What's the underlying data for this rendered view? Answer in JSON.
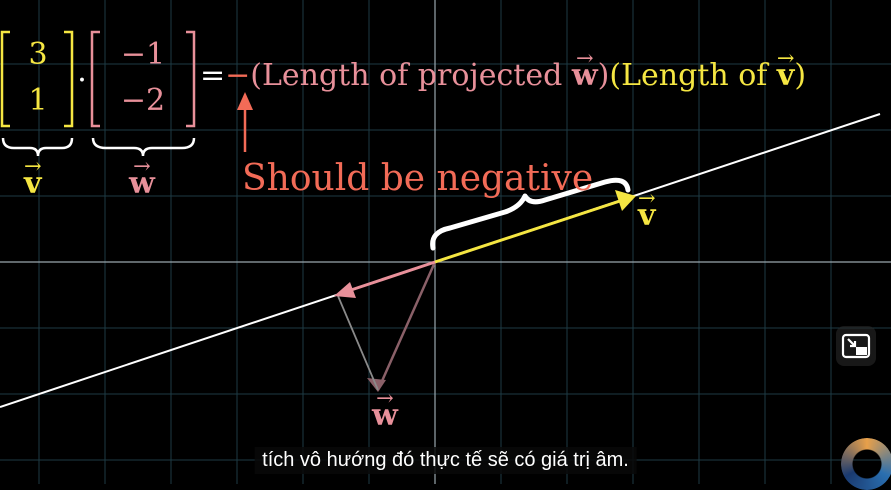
{
  "matrix_v": {
    "top": "3",
    "bottom": "1"
  },
  "matrix_w": {
    "top": "−1",
    "bottom": "−2"
  },
  "dot_symbol": "·",
  "equation": {
    "equals": "=",
    "minus": "−",
    "part1_open": "(Length of projected ",
    "part1_vec": "w",
    "part1_close": ")",
    "part2_open": "(Length of ",
    "part2_vec": "v",
    "part2_close": ")"
  },
  "annotation": "Should be negative",
  "labels": {
    "v": "v",
    "w": "w",
    "v_under": "v",
    "w_under": "w"
  },
  "subtitle": "tích vô hướng đó thực tế sẽ có giá trị âm.",
  "colors": {
    "v": "#f5e642",
    "w": "#e8909a",
    "annotation": "#f26b57",
    "grid": "#1e3a44",
    "axes": "#9aa7ad",
    "projection_line": "#ffffff"
  },
  "icons": {
    "pip": "picture-in-picture-icon",
    "loader": "loading-spinner-icon"
  }
}
